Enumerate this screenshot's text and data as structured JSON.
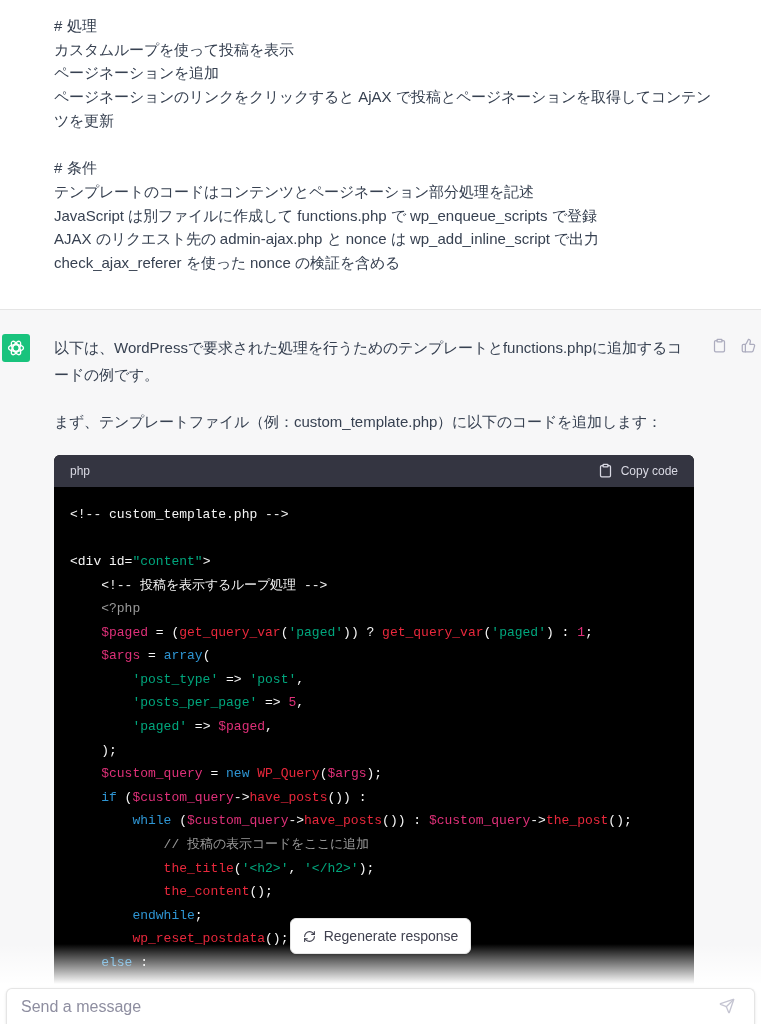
{
  "user_message": {
    "sections": [
      {
        "lines": [
          "# 処理",
          "カスタムループを使って投稿を表示",
          "ページネーションを追加",
          "ページネーションのリンクをクリックすると AjAX で投稿とページネーションを取得してコンテンツを更新"
        ]
      },
      {
        "lines": [
          "# 条件",
          "テンプレートのコードはコンテンツとページネーション部分処理を記述",
          "JavaScript は別ファイルに作成して functions.php で wp_enqueue_scripts で登録",
          "AJAX のリクエスト先の  admin-ajax.php と nonce は wp_add_inline_script で出力",
          "check_ajax_referer を使った nonce の検証を含める"
        ]
      }
    ]
  },
  "assistant_message": {
    "paragraphs": [
      "以下は、WordPressで要求された処理を行うためのテンプレートとfunctions.phpに追加するコードの例です。",
      "まず、テンプレートファイル（例：custom_template.php）に以下のコードを追加します："
    ],
    "code_block": {
      "language": "php",
      "copy_label": "Copy code",
      "lines": [
        {
          "blank_before": false,
          "tokens": [
            {
              "text": "<!-- custom_template.php -->",
              "kind": "comment"
            }
          ]
        },
        {
          "blank_before": true,
          "tokens": [
            {
              "text": "<div id=",
              "kind": "plain"
            },
            {
              "text": "\"content\"",
              "kind": "string"
            },
            {
              "text": ">",
              "kind": "plain"
            }
          ]
        },
        {
          "blank_before": false,
          "tokens": [
            {
              "text": "    <!-- 投稿を表示するループ処理 -->",
              "kind": "comment"
            }
          ]
        },
        {
          "blank_before": false,
          "tokens": [
            {
              "text": "    <?php",
              "kind": "meta"
            }
          ]
        },
        {
          "blank_before": false,
          "tokens": [
            {
              "text": "    $paged",
              "kind": "var"
            },
            {
              "text": " = (",
              "kind": "plain"
            },
            {
              "text": "get_query_var",
              "kind": "func"
            },
            {
              "text": "(",
              "kind": "plain"
            },
            {
              "text": "'paged'",
              "kind": "string"
            },
            {
              "text": ")) ? ",
              "kind": "plain"
            },
            {
              "text": "get_query_var",
              "kind": "func"
            },
            {
              "text": "(",
              "kind": "plain"
            },
            {
              "text": "'paged'",
              "kind": "string"
            },
            {
              "text": ") : ",
              "kind": "plain"
            },
            {
              "text": "1",
              "kind": "number"
            },
            {
              "text": ";",
              "kind": "plain"
            }
          ]
        },
        {
          "blank_before": false,
          "tokens": [
            {
              "text": "    $args",
              "kind": "var"
            },
            {
              "text": " = ",
              "kind": "plain"
            },
            {
              "text": "array",
              "kind": "keyword"
            },
            {
              "text": "(",
              "kind": "plain"
            }
          ]
        },
        {
          "blank_before": false,
          "tokens": [
            {
              "text": "        'post_type'",
              "kind": "string"
            },
            {
              "text": " => ",
              "kind": "plain"
            },
            {
              "text": "'post'",
              "kind": "string"
            },
            {
              "text": ",",
              "kind": "plain"
            }
          ]
        },
        {
          "blank_before": false,
          "tokens": [
            {
              "text": "        'posts_per_page'",
              "kind": "string"
            },
            {
              "text": " => ",
              "kind": "plain"
            },
            {
              "text": "5",
              "kind": "number"
            },
            {
              "text": ",",
              "kind": "plain"
            }
          ]
        },
        {
          "blank_before": false,
          "tokens": [
            {
              "text": "        'paged'",
              "kind": "string"
            },
            {
              "text": " => ",
              "kind": "plain"
            },
            {
              "text": "$paged",
              "kind": "var"
            },
            {
              "text": ",",
              "kind": "plain"
            }
          ]
        },
        {
          "blank_before": false,
          "tokens": [
            {
              "text": "    );",
              "kind": "plain"
            }
          ]
        },
        {
          "blank_before": false,
          "tokens": [
            {
              "text": "    $custom_query",
              "kind": "var"
            },
            {
              "text": " = ",
              "kind": "plain"
            },
            {
              "text": "new ",
              "kind": "keyword"
            },
            {
              "text": "WP_Query",
              "kind": "func"
            },
            {
              "text": "(",
              "kind": "plain"
            },
            {
              "text": "$args",
              "kind": "var"
            },
            {
              "text": ");",
              "kind": "plain"
            }
          ]
        },
        {
          "blank_before": false,
          "tokens": [
            {
              "text": "    if",
              "kind": "keyword"
            },
            {
              "text": " (",
              "kind": "plain"
            },
            {
              "text": "$custom_query",
              "kind": "var"
            },
            {
              "text": "->",
              "kind": "plain"
            },
            {
              "text": "have_posts",
              "kind": "func"
            },
            {
              "text": "()) :",
              "kind": "plain"
            }
          ]
        },
        {
          "blank_before": false,
          "tokens": [
            {
              "text": "        while",
              "kind": "keyword"
            },
            {
              "text": " (",
              "kind": "plain"
            },
            {
              "text": "$custom_query",
              "kind": "var"
            },
            {
              "text": "->",
              "kind": "plain"
            },
            {
              "text": "have_posts",
              "kind": "func"
            },
            {
              "text": "()) : ",
              "kind": "plain"
            },
            {
              "text": "$custom_query",
              "kind": "var"
            },
            {
              "text": "->",
              "kind": "plain"
            },
            {
              "text": "the_post",
              "kind": "func"
            },
            {
              "text": "();",
              "kind": "plain"
            }
          ]
        },
        {
          "blank_before": false,
          "tokens": [
            {
              "text": "            // 投稿の表示コードをここに追加",
              "kind": "meta"
            }
          ]
        },
        {
          "blank_before": false,
          "tokens": [
            {
              "text": "            the_title",
              "kind": "func"
            },
            {
              "text": "(",
              "kind": "plain"
            },
            {
              "text": "'<h2>'",
              "kind": "string"
            },
            {
              "text": ", ",
              "kind": "plain"
            },
            {
              "text": "'</h2>'",
              "kind": "string"
            },
            {
              "text": ");",
              "kind": "plain"
            }
          ]
        },
        {
          "blank_before": false,
          "tokens": [
            {
              "text": "            the_content",
              "kind": "func"
            },
            {
              "text": "();",
              "kind": "plain"
            }
          ]
        },
        {
          "blank_before": false,
          "tokens": [
            {
              "text": "        endwhile",
              "kind": "keyword"
            },
            {
              "text": ";",
              "kind": "plain"
            }
          ]
        },
        {
          "blank_before": false,
          "tokens": [
            {
              "text": "        wp_reset_postdata",
              "kind": "func"
            },
            {
              "text": "();",
              "kind": "plain"
            }
          ]
        },
        {
          "blank_before": false,
          "tokens": [
            {
              "text": "    else",
              "kind": "keyword"
            },
            {
              "text": " :",
              "kind": "plain"
            }
          ]
        }
      ]
    }
  },
  "regenerate_button": {
    "label": "Regenerate response"
  },
  "composer": {
    "placeholder": "Send a message"
  }
}
